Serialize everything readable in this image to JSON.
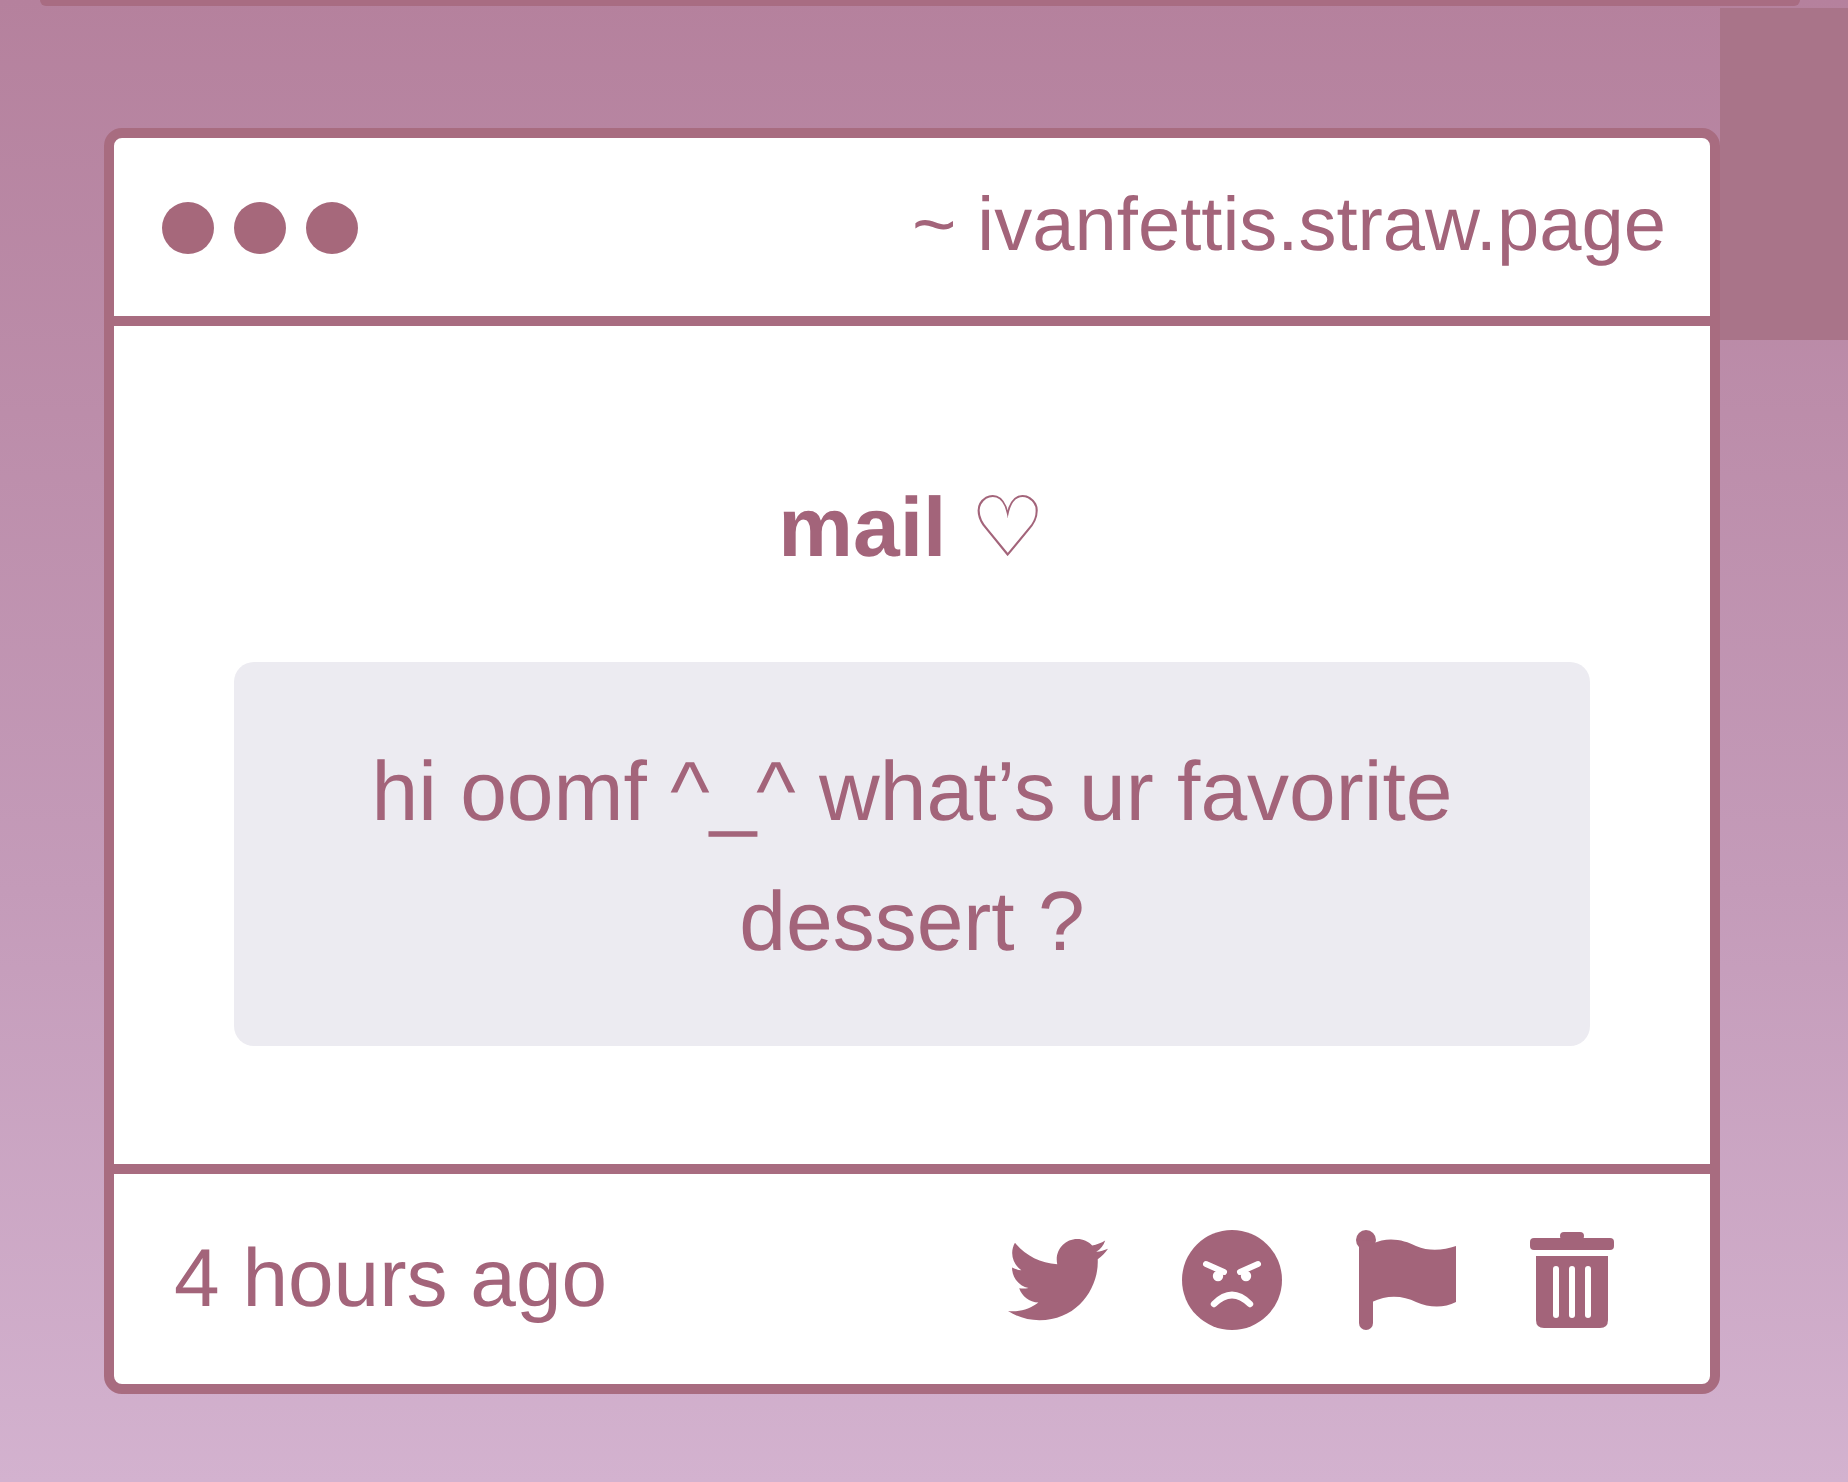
{
  "window": {
    "url": "~ ivanfettis.straw.page"
  },
  "post": {
    "title": "**mail** ♡",
    "message": "hi oomf ^_^ what’s ur favorite dessert ?",
    "time": "4 hours ago",
    "actions": [
      {
        "kind": "bird"
      },
      {
        "kind": "angry"
      },
      {
        "kind": "flag"
      },
      {
        "kind": "trash"
      }
    ]
  }
}
